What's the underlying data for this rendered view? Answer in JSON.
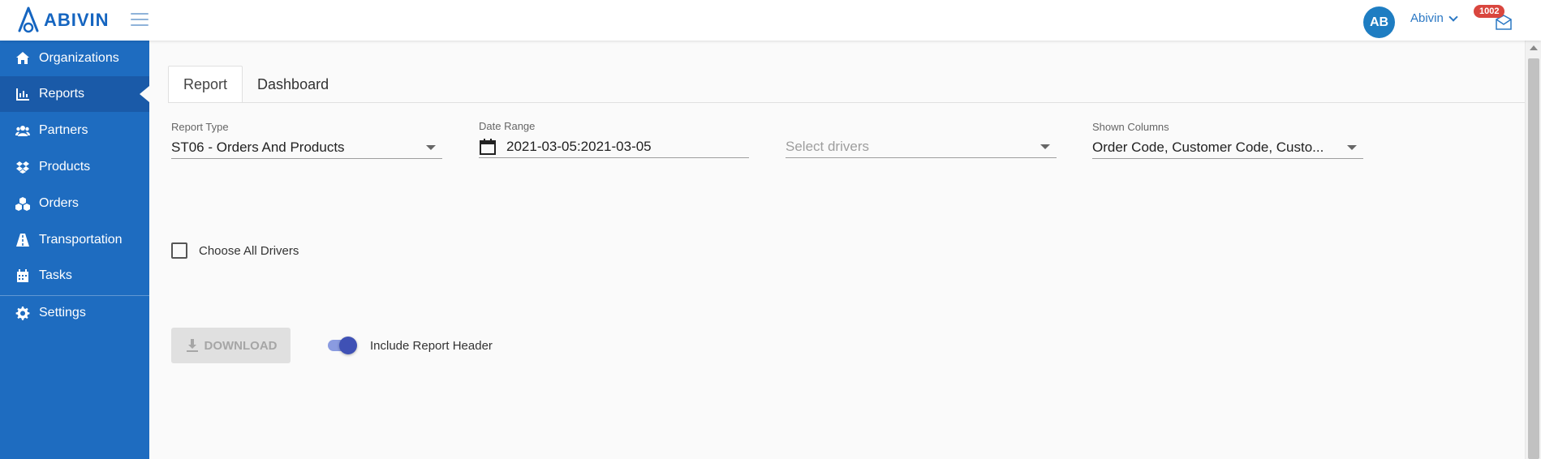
{
  "brand": {
    "name": "ABIVIN",
    "color": "#1565c0"
  },
  "user": {
    "initials": "AB",
    "name": "Abivin"
  },
  "notifications": {
    "count": "1002"
  },
  "sidebar": {
    "items": [
      {
        "label": "Organizations",
        "icon": "home-icon"
      },
      {
        "label": "Reports",
        "icon": "bar-chart-icon",
        "active": true
      },
      {
        "label": "Partners",
        "icon": "users-icon"
      },
      {
        "label": "Products",
        "icon": "dropbox-icon"
      },
      {
        "label": "Orders",
        "icon": "cubes-icon"
      },
      {
        "label": "Transportation",
        "icon": "road-icon"
      },
      {
        "label": "Tasks",
        "icon": "calendar-icon"
      },
      {
        "label": "Settings",
        "icon": "gear-icon"
      }
    ]
  },
  "tabs": [
    {
      "label": "Report",
      "active": true
    },
    {
      "label": "Dashboard",
      "active": false
    }
  ],
  "form": {
    "report_type": {
      "label": "Report Type",
      "value": "ST06 - Orders And Products"
    },
    "date_range": {
      "label": "Date Range",
      "value": "2021-03-05:2021-03-05"
    },
    "drivers": {
      "placeholder": "Select drivers"
    },
    "shown_columns": {
      "label": "Shown Columns",
      "value": "Order Code, Customer Code, Custo..."
    },
    "choose_all_drivers": {
      "label": "Choose All Drivers",
      "checked": false
    },
    "download": {
      "label": "DOWNLOAD",
      "disabled": true
    },
    "include_header": {
      "label": "Include Report Header",
      "on": true
    }
  },
  "colors": {
    "sidebar_bg": "#1e6cc0",
    "sidebar_active": "#1a5aa8",
    "avatar_bg": "#1e7dc2",
    "badge_bg": "#d9463e",
    "toggle_on": "#3f51b5"
  }
}
